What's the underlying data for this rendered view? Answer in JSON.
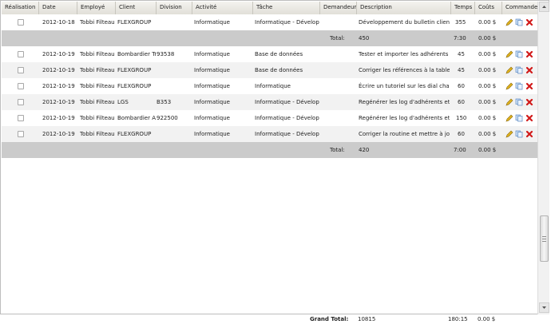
{
  "columns": [
    "Réalisation",
    "Date",
    "Employé",
    "Client",
    "Division",
    "Activité",
    "Tâche",
    "Demandeur",
    "Description",
    "Temps",
    "Coûts",
    "Commandes"
  ],
  "rows": [
    {
      "type": "data",
      "date": "2012-10-18",
      "employe": "Tobbi Filteau",
      "client": "FLEXGROUP",
      "division": "",
      "activite": "Informatique",
      "tache": "Informatique - Développ",
      "demandeur": "",
      "description": "Développement du bulletin client",
      "temps": "355",
      "couts": "0.00 $"
    },
    {
      "type": "total",
      "label": "Total:",
      "description": "450",
      "temps": "7:30",
      "couts": "0.00 $"
    },
    {
      "type": "data",
      "date": "2012-10-19",
      "employe": "Tobbi Filteau",
      "client": "Bombardier Tr",
      "division": "93538",
      "activite": "Informatique",
      "tache": "Base de données",
      "demandeur": "",
      "description": "Tester et importer les adhérents",
      "temps": "45",
      "couts": "0.00 $"
    },
    {
      "type": "data",
      "date": "2012-10-19",
      "employe": "Tobbi Filteau",
      "client": "FLEXGROUP",
      "division": "",
      "activite": "Informatique",
      "tache": "Base de données",
      "demandeur": "",
      "description": "Corriger les références à la table t",
      "temps": "45",
      "couts": "0.00 $"
    },
    {
      "type": "data",
      "date": "2012-10-19",
      "employe": "Tobbi Filteau",
      "client": "FLEXGROUP",
      "division": "",
      "activite": "Informatique",
      "tache": "Informatique",
      "demandeur": "",
      "description": "Écrire un tutoriel sur les dial chart c",
      "temps": "60",
      "couts": "0.00 $"
    },
    {
      "type": "data",
      "date": "2012-10-19",
      "employe": "Tobbi Filteau",
      "client": "LGS",
      "division": "B353",
      "activite": "Informatique",
      "tache": "Informatique - Développ",
      "demandeur": "",
      "description": "Regénérer les log d'adhérents et te",
      "temps": "60",
      "couts": "0.00 $"
    },
    {
      "type": "data",
      "date": "2012-10-19",
      "employe": "Tobbi Filteau",
      "client": "Bombardier Ae",
      "division": "922500",
      "activite": "Informatique",
      "tache": "Informatique - Développ",
      "demandeur": "",
      "description": "Regénérer les log d'adhérents et te",
      "temps": "150",
      "couts": "0.00 $"
    },
    {
      "type": "data",
      "date": "2012-10-19",
      "employe": "Tobbi Filteau",
      "client": "FLEXGROUP",
      "division": "",
      "activite": "Informatique",
      "tache": "Informatique - Développ",
      "demandeur": "",
      "description": "Corriger la routine et mettre à jour",
      "temps": "60",
      "couts": "0.00 $"
    },
    {
      "type": "total",
      "label": "Total:",
      "description": "420",
      "temps": "7:00",
      "couts": "0.00 $"
    }
  ],
  "footer": {
    "label": "Grand Total:",
    "description": "10815",
    "temps": "180:15",
    "couts": "0.00 $"
  },
  "icons": {
    "edit": "pencil-icon",
    "copy": "copy-icon",
    "delete": "delete-icon"
  },
  "colors": {
    "total_row": "#cbcbcb",
    "alt_row": "#f2f2f2",
    "delete": "#d11a1a",
    "edit": "#e0b21c",
    "copy": "#6b9fd6"
  }
}
